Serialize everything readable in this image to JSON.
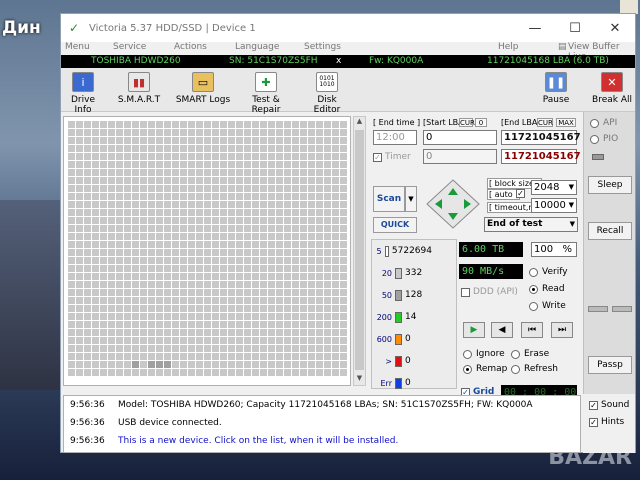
{
  "desktop": {
    "left_text": "Дин",
    "watermark": "BAZAR"
  },
  "window": {
    "title": "Victoria 5.37 HDD/SSD | Device 1",
    "controls": {
      "minimize": "—",
      "maximize": "☐",
      "close": "✕"
    }
  },
  "menu": {
    "items": [
      "Menu",
      "Service",
      "Actions",
      "Language",
      "Settings",
      "Help"
    ],
    "view_buffer": "View Buffer Live"
  },
  "device_bar": {
    "model": "TOSHIBA HDWD260",
    "serial": "SN: 51C1S70ZS5FH",
    "close_mark": "x",
    "firmware": "Fw: KQ000A",
    "lba": "11721045168 LBA (6.0 TB)"
  },
  "toolbar": {
    "drive_info": "Drive Info",
    "smart": "S.M.A.R.T",
    "smart_logs": "SMART Logs",
    "test_repair": "Test & Repair",
    "disk_editor": "Disk Editor",
    "pause": "Pause",
    "break_all": "Break All"
  },
  "scan": {
    "end_time_label": "[ End time ]",
    "start_lba_label": "[Start LBA]",
    "cur_label": "CUR",
    "cur_value": "0",
    "end_lba_label": "[End LBA]",
    "cur2_label": "CUR",
    "max_label": "MAX",
    "time_value": "12:00",
    "start_lba_value": "0",
    "end_lba_value": "11721045167",
    "timer_label": "Timer",
    "timer_value": "0",
    "end_lba_value2": "11721045167",
    "scan_button": "Scan",
    "quick_button": "QUICK",
    "block_size_label": "[ block size ]",
    "auto_label": "[ auto ]",
    "block_size_value": "2048",
    "timeout_label": "[ timeout,ms ]",
    "timeout_value": "10000",
    "end_mode": "End of test"
  },
  "blocks": [
    {
      "label": "5",
      "count": "5722694",
      "color": "#ffffff"
    },
    {
      "label": "20",
      "count": "332",
      "color": "#c8c8c8"
    },
    {
      "label": "50",
      "count": "128",
      "color": "#a0a0a0"
    },
    {
      "label": "200",
      "count": "14",
      "color": "#22cc22"
    },
    {
      "label": "600",
      "count": "0",
      "color": "#ff8c00"
    },
    {
      "label": ">",
      "count": "0",
      "color": "#e01010"
    },
    {
      "label": "Err",
      "count": "0",
      "color": "#1040e0"
    }
  ],
  "stats": {
    "size": "6.00 TB",
    "percent": "100",
    "percent_unit": "%",
    "speed": "90 MB/s",
    "ddd": "DDD (API)",
    "verify": "Verify",
    "read": "Read",
    "write": "Write",
    "ignore": "Ignore",
    "erase": "Erase",
    "remap": "Remap",
    "refresh": "Refresh",
    "grid": "Grid",
    "grid_time": "00 : 00 : 00"
  },
  "right_panel": {
    "api": "API",
    "pio": "PIO",
    "sleep": "Sleep",
    "recall": "Recall",
    "passp": "Passp"
  },
  "log": [
    {
      "time": "9:56:36",
      "message": "Model: TOSHIBA HDWD260; Capacity 11721045168 LBAs; SN: 51C1S70ZS5FH; FW: KQ000A",
      "color": "#000000"
    },
    {
      "time": "9:56:36",
      "message": "USB device connected.",
      "color": "#000000"
    },
    {
      "time": "9:56:36",
      "message": "This is a new device. Click on the list, when it will be installed.",
      "color": "#1010c8"
    }
  ],
  "log_options": {
    "sound": "Sound",
    "hints": "Hints"
  }
}
